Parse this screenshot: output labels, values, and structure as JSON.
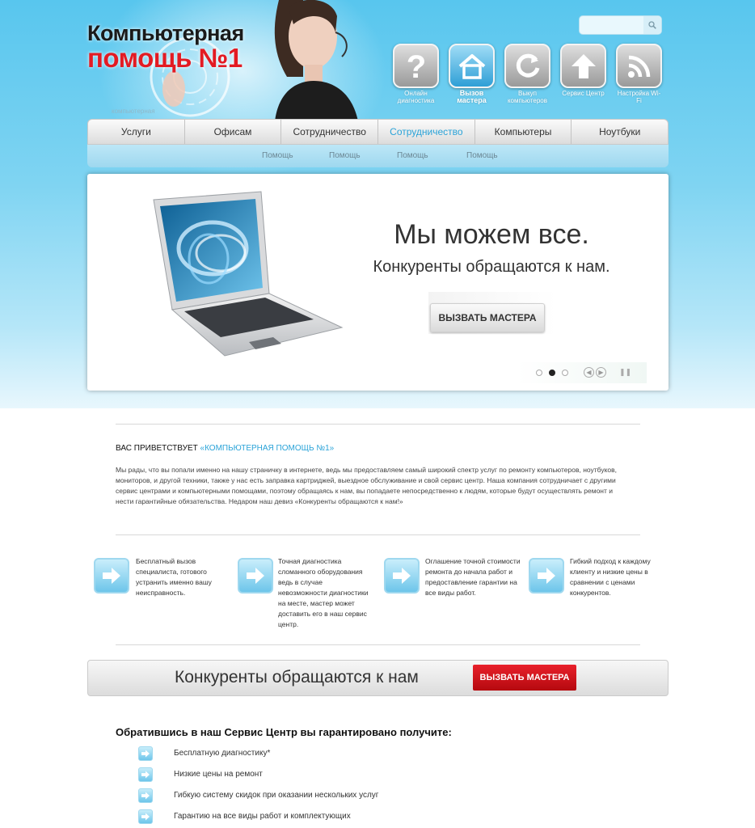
{
  "header": {
    "logo_line1": "Компьютерная",
    "logo_line2": "помощь №1",
    "logo_sub": "компьютерная"
  },
  "search": {
    "placeholder": ""
  },
  "top_icons": [
    {
      "icon": "question-icon",
      "label": "Онлайн диагностика"
    },
    {
      "icon": "home-icon",
      "label": "Вызов мастера",
      "active": true
    },
    {
      "icon": "refresh-icon",
      "label": "Выкуп компьютеров"
    },
    {
      "icon": "upload-arrow-icon",
      "label": "Сервис Центр"
    },
    {
      "icon": "rss-icon",
      "label": "Настройка Wi-Fi"
    }
  ],
  "nav": {
    "items": [
      "Услуги",
      "Офисам",
      "Сотрудничество",
      "Сотрудничество",
      "Компьютеры",
      "Ноутбуки"
    ],
    "active_index": 3,
    "sub_items": [
      "Помощь",
      "Помощь",
      "Помощь",
      "Помощь"
    ]
  },
  "slider": {
    "title": "Мы можем все.",
    "subtitle": "Конкуренты обращаются к нам.",
    "button": "ВЫЗВАТЬ МАСТЕРА",
    "slide_count": 3,
    "active_slide": 2
  },
  "welcome": {
    "heading_prefix": "ВАС ПРИВЕТСТВУЕТ ",
    "heading_brand": "«КОМПЬЮТЕРНАЯ ПОМОЩЬ №1»",
    "text": "Мы рады, что вы попали именно на нашу страничку в интернете, ведь мы предоставляем самый широкий спектр услуг по ремонту компьютеров, ноутбуков, мониторов, и другой техники, также у нас есть заправка картриджей, выездное обслуживание и свой сервис центр. Наша компания сотрудничает с другими сервис центрами и компьютерными помощами, поэтому обращаясь к нам, вы попадаете непосредственно к людям, которые будут осуществлять ремонт и нести гарантийные обязательства. Недаром наш девиз «Конкуренты обращаются к нам!»"
  },
  "features": [
    "Бесплатный вызов специалиста, готового устранить именно вашу неисправность.",
    "Точная диагностика сломанного оборудования ведь в случае невозможности диагностики на месте, мастер может доставить его в наш сервис центр.",
    "Оглашение точной стоимости ремонта до начала работ и предоставление гарантии на все виды работ.",
    "Гибкий подход к каждому клиенту и низкие цены в сравнении с ценами конкурентов."
  ],
  "cta": {
    "text": "Конкуренты обращаются к нам",
    "button": "ВЫЗВАТЬ МАСТЕРА"
  },
  "guarantees": {
    "title": "Обратившись в наш Сервис Центр вы гарантировано получите:",
    "items": [
      "Бесплатную диагностику*",
      "Низкие цены на ремонт",
      "Гибкую систему скидок при оказании нескольких услуг",
      "Гарантию на все виды работ и комплектующих"
    ]
  },
  "colors": {
    "sky": "#58c6ee",
    "accent_blue": "#2aa3d8",
    "brand_red": "#e31b23"
  }
}
